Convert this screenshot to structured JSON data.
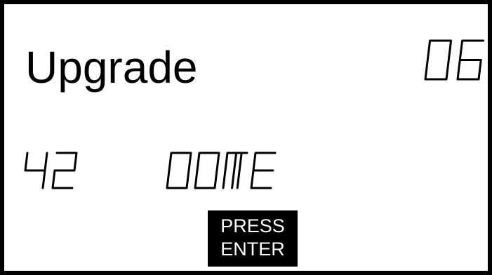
{
  "screen": {
    "title": "Upgrade",
    "counter": "06",
    "left_value": "42",
    "status": "DONE",
    "button": {
      "line1": "PRESS",
      "line2": "ENTER"
    }
  },
  "colors": {
    "foreground": "#000000",
    "background": "#ffffff"
  }
}
